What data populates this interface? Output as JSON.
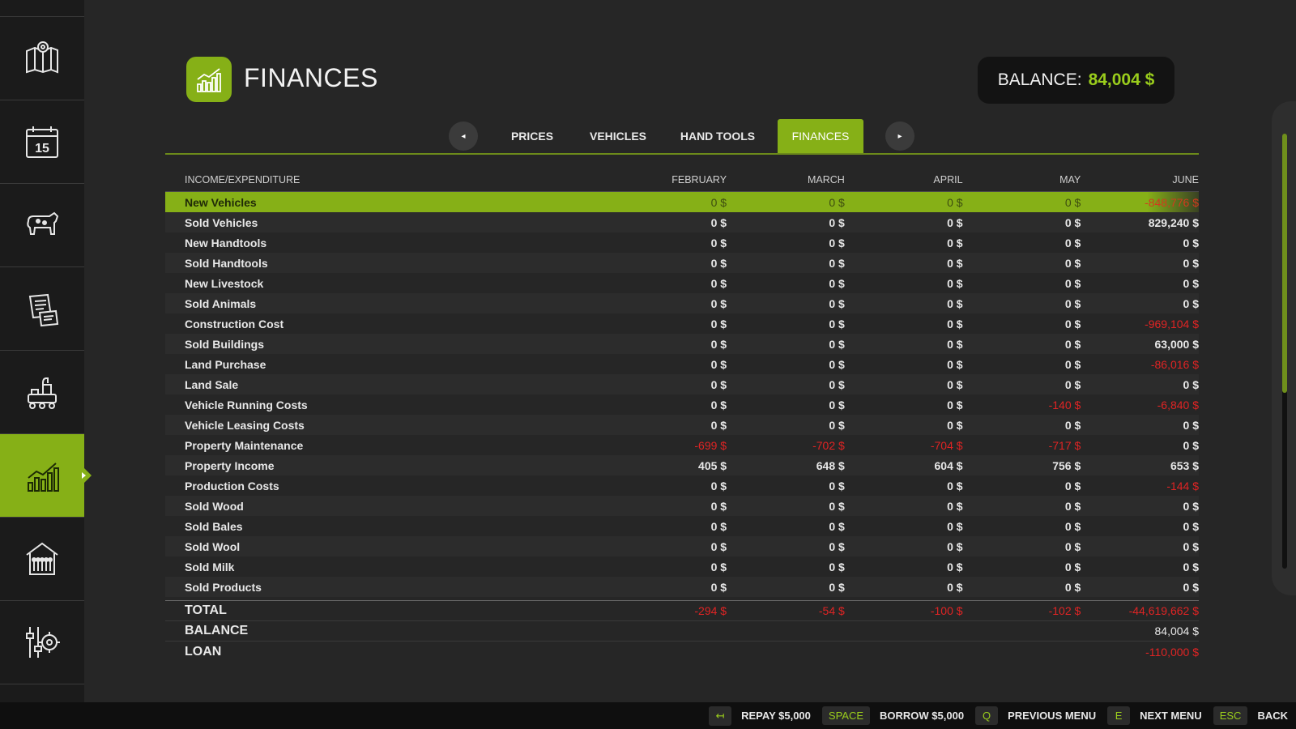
{
  "header": {
    "title": "FINANCES",
    "balance_label": "BALANCE:",
    "balance_value": "84,004 $"
  },
  "sidebar": {
    "items": [
      {
        "icon": "map-icon"
      },
      {
        "icon": "calendar-icon",
        "day": "15"
      },
      {
        "icon": "cow-icon"
      },
      {
        "icon": "contracts-icon"
      },
      {
        "icon": "production-icon"
      },
      {
        "icon": "finances-chart-icon",
        "active": true
      },
      {
        "icon": "animals-barn-icon"
      },
      {
        "icon": "settings-icon"
      }
    ]
  },
  "tabs": {
    "prev": "◂",
    "next": "▸",
    "items": [
      "PRICES",
      "VEHICLES",
      "HAND TOOLS",
      "FINANCES"
    ],
    "active": "FINANCES"
  },
  "table": {
    "headers": [
      "INCOME/EXPENDITURE",
      "FEBRUARY",
      "MARCH",
      "APRIL",
      "MAY",
      "JUNE"
    ],
    "rows": [
      {
        "label": "New Vehicles",
        "values": [
          "0 $",
          "0 $",
          "0 $",
          "0 $",
          "-848,776 $"
        ]
      },
      {
        "label": "Sold Vehicles",
        "values": [
          "0 $",
          "0 $",
          "0 $",
          "0 $",
          "829,240 $"
        ]
      },
      {
        "label": "New Handtools",
        "values": [
          "0 $",
          "0 $",
          "0 $",
          "0 $",
          "0 $"
        ]
      },
      {
        "label": "Sold Handtools",
        "values": [
          "0 $",
          "0 $",
          "0 $",
          "0 $",
          "0 $"
        ]
      },
      {
        "label": "New Livestock",
        "values": [
          "0 $",
          "0 $",
          "0 $",
          "0 $",
          "0 $"
        ]
      },
      {
        "label": "Sold Animals",
        "values": [
          "0 $",
          "0 $",
          "0 $",
          "0 $",
          "0 $"
        ]
      },
      {
        "label": "Construction Cost",
        "values": [
          "0 $",
          "0 $",
          "0 $",
          "0 $",
          "-969,104 $"
        ]
      },
      {
        "label": "Sold Buildings",
        "values": [
          "0 $",
          "0 $",
          "0 $",
          "0 $",
          "63,000 $"
        ]
      },
      {
        "label": "Land Purchase",
        "values": [
          "0 $",
          "0 $",
          "0 $",
          "0 $",
          "-86,016 $"
        ]
      },
      {
        "label": "Land Sale",
        "values": [
          "0 $",
          "0 $",
          "0 $",
          "0 $",
          "0 $"
        ]
      },
      {
        "label": "Vehicle Running Costs",
        "values": [
          "0 $",
          "0 $",
          "0 $",
          "-140 $",
          "-6,840 $"
        ]
      },
      {
        "label": "Vehicle Leasing Costs",
        "values": [
          "0 $",
          "0 $",
          "0 $",
          "0 $",
          "0 $"
        ]
      },
      {
        "label": "Property Maintenance",
        "values": [
          "-699 $",
          "-702 $",
          "-704 $",
          "-717 $",
          "0 $"
        ]
      },
      {
        "label": "Property Income",
        "values": [
          "405 $",
          "648 $",
          "604 $",
          "756 $",
          "653 $"
        ]
      },
      {
        "label": "Production Costs",
        "values": [
          "0 $",
          "0 $",
          "0 $",
          "0 $",
          "-144 $"
        ]
      },
      {
        "label": "Sold Wood",
        "values": [
          "0 $",
          "0 $",
          "0 $",
          "0 $",
          "0 $"
        ]
      },
      {
        "label": "Sold Bales",
        "values": [
          "0 $",
          "0 $",
          "0 $",
          "0 $",
          "0 $"
        ]
      },
      {
        "label": "Sold Wool",
        "values": [
          "0 $",
          "0 $",
          "0 $",
          "0 $",
          "0 $"
        ]
      },
      {
        "label": "Sold Milk",
        "values": [
          "0 $",
          "0 $",
          "0 $",
          "0 $",
          "0 $"
        ]
      },
      {
        "label": "Sold Products",
        "values": [
          "0 $",
          "0 $",
          "0 $",
          "0 $",
          "0 $"
        ]
      }
    ],
    "totals": [
      {
        "label": "TOTAL",
        "values": [
          "-294 $",
          "-54 $",
          "-100 $",
          "-102 $",
          "-44,619,662 $"
        ]
      },
      {
        "label": "BALANCE",
        "values": [
          "",
          "",
          "",
          "",
          "84,004 $"
        ]
      },
      {
        "label": "LOAN",
        "values": [
          "",
          "",
          "",
          "",
          "-110,000 $"
        ]
      }
    ]
  },
  "bottombar": {
    "hints": [
      {
        "key": "↤",
        "label": "REPAY $5,000"
      },
      {
        "key": "SPACE",
        "label": "BORROW $5,000"
      },
      {
        "key": "Q",
        "label": "PREVIOUS MENU"
      },
      {
        "key": "E",
        "label": "NEXT MENU"
      },
      {
        "key": "ESC",
        "label": "BACK"
      }
    ]
  },
  "colors": {
    "accent": "#86b017",
    "negative": "#e02424",
    "background": "#262626"
  }
}
